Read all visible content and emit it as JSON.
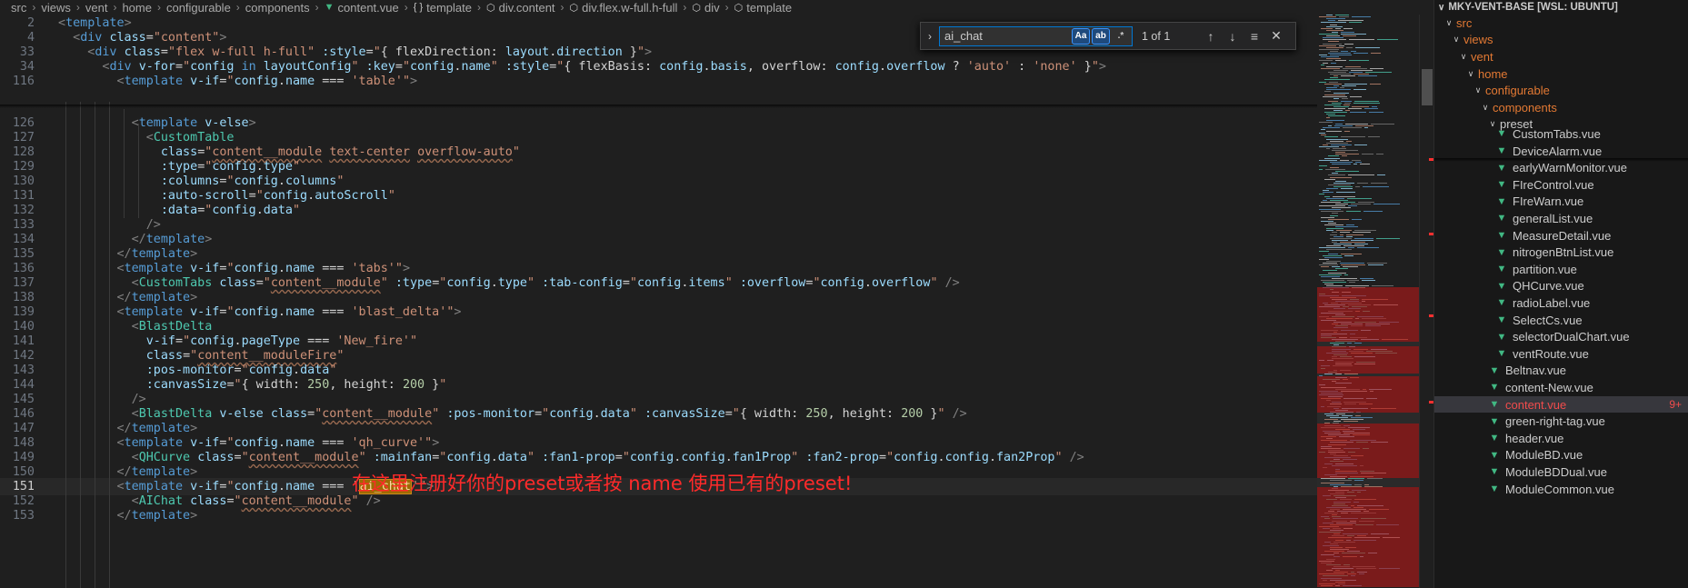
{
  "breadcrumb": [
    {
      "label": "src",
      "icon": ""
    },
    {
      "label": "views",
      "icon": ""
    },
    {
      "label": "vent",
      "icon": ""
    },
    {
      "label": "home",
      "icon": ""
    },
    {
      "label": "configurable",
      "icon": ""
    },
    {
      "label": "components",
      "icon": ""
    },
    {
      "label": "content.vue",
      "icon": "vue-icon"
    },
    {
      "label": "template",
      "icon": "braces-icon"
    },
    {
      "label": "div.content",
      "icon": "element-icon"
    },
    {
      "label": "div.flex.w-full.h-full",
      "icon": "element-icon"
    },
    {
      "label": "div",
      "icon": "element-icon"
    },
    {
      "label": "template",
      "icon": "element-icon"
    }
  ],
  "find": {
    "query": "ai_chat",
    "result": "1 of 1",
    "match_case": "Aa",
    "whole_word": "ab",
    "regex": ".*"
  },
  "annotation": "在这里注册好你的preset或者按 name 使用已有的preset!",
  "explorer": {
    "root": "MKY-VENT-BASE [WSL: UBUNTU]",
    "folders": [
      "src",
      "views",
      "vent",
      "home",
      "configurable",
      "components",
      "preset"
    ],
    "files": [
      {
        "name": "CustomTabs.vue",
        "modified": true
      },
      {
        "name": "DeviceAlarm.vue",
        "modified": false
      },
      {
        "name": "earlyWarnMonitor.vue",
        "modified": false
      },
      {
        "name": "FIreControl.vue",
        "modified": false
      },
      {
        "name": "FIreWarn.vue",
        "modified": false
      },
      {
        "name": "generalList.vue",
        "modified": false
      },
      {
        "name": "MeasureDetail.vue",
        "modified": false
      },
      {
        "name": "nitrogenBtnList.vue",
        "modified": false
      },
      {
        "name": "partition.vue",
        "modified": false
      },
      {
        "name": "QHCurve.vue",
        "modified": false
      },
      {
        "name": "radioLabel.vue",
        "modified": false
      },
      {
        "name": "SelectCs.vue",
        "modified": false
      },
      {
        "name": "selectorDualChart.vue",
        "modified": false
      },
      {
        "name": "ventRoute.vue",
        "modified": false
      }
    ],
    "siblings": [
      {
        "name": "Beltnav.vue",
        "state": "normal"
      },
      {
        "name": "content-New.vue",
        "state": "normal"
      },
      {
        "name": "content.vue",
        "state": "error",
        "badge": "9+"
      },
      {
        "name": "green-right-tag.vue",
        "state": "normal"
      },
      {
        "name": "header.vue",
        "state": "normal"
      },
      {
        "name": "ModuleBD.vue",
        "state": "normal"
      },
      {
        "name": "ModuleBDDual.vue",
        "state": "normal"
      },
      {
        "name": "ModuleCommon.vue",
        "state": "normal"
      }
    ]
  },
  "colors": {
    "accent": "#0078d4",
    "error": "#f14c4c",
    "vue": "#41b883",
    "annotation": "#ff2a2a"
  }
}
